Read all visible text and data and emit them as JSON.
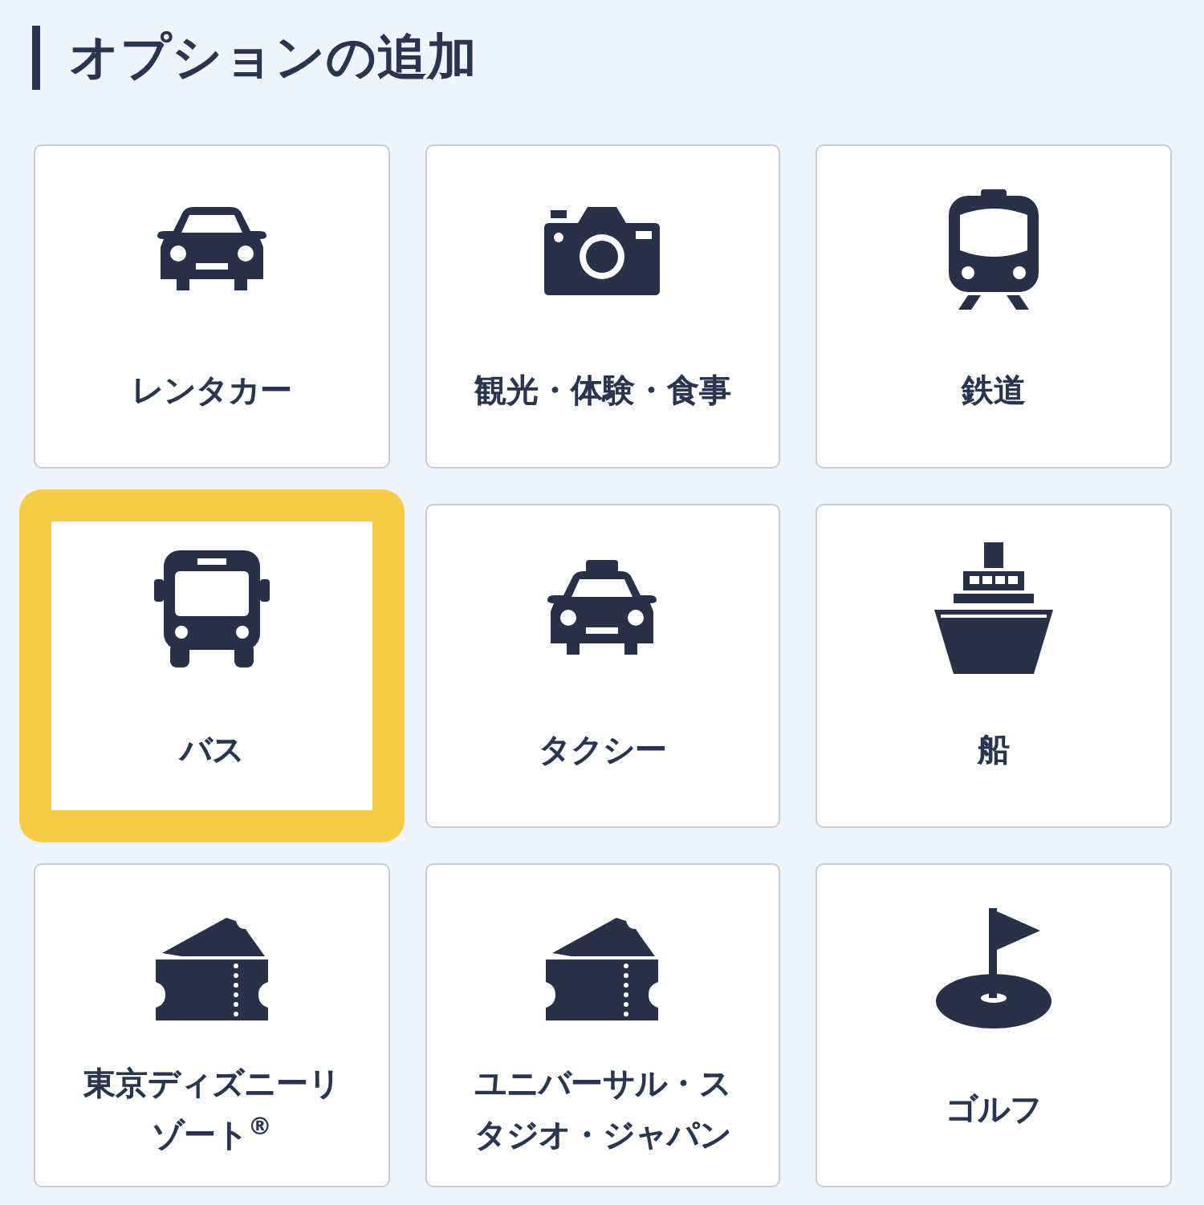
{
  "title": "オプションの追加",
  "options": [
    {
      "label": "レンタカー",
      "kind": "car",
      "selected": false
    },
    {
      "label": "観光・体験・食事",
      "kind": "camera",
      "selected": false
    },
    {
      "label": "鉄道",
      "kind": "train",
      "selected": false
    },
    {
      "label": "バス",
      "kind": "bus",
      "selected": true
    },
    {
      "label": "タクシー",
      "kind": "taxi",
      "selected": false
    },
    {
      "label": "船",
      "kind": "ship",
      "selected": false
    },
    {
      "label": "東京ディズニーリゾート$^{®}$",
      "kind": "ticket",
      "selected": false
    },
    {
      "label": "ユニバーサル・スタジオ・ジャパン",
      "kind": "ticket",
      "selected": false
    },
    {
      "label": "ゴルフ",
      "kind": "golf",
      "selected": false
    }
  ]
}
